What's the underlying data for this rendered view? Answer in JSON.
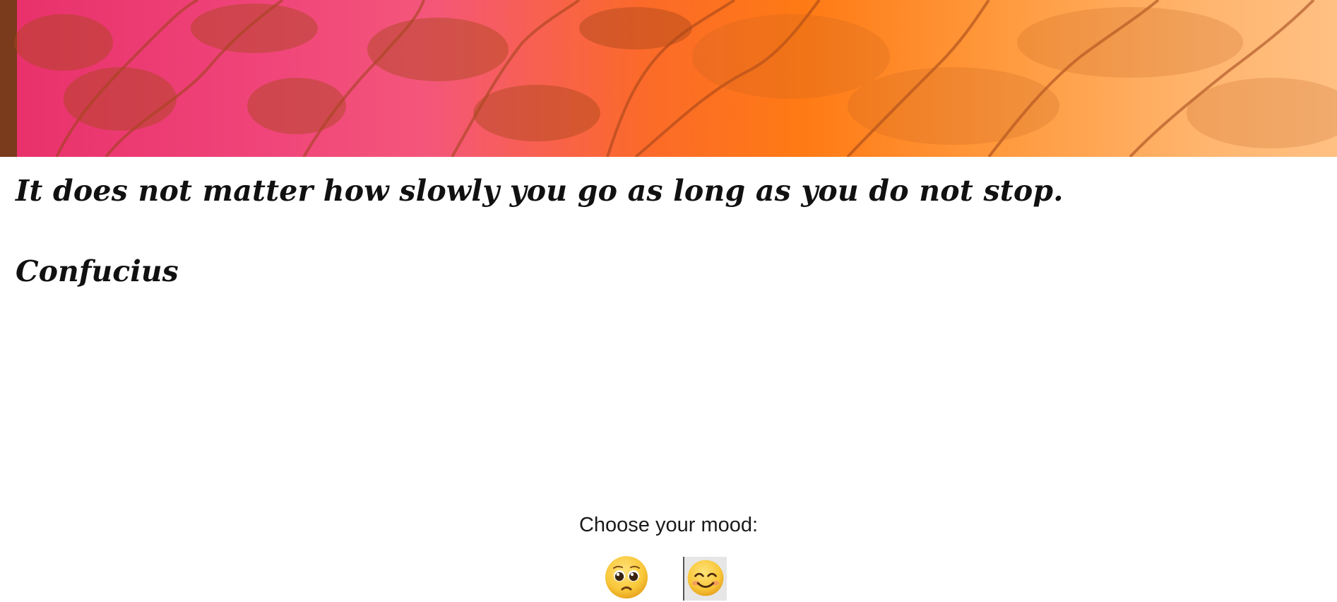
{
  "hero": {
    "image": "orange-pink-tree-silhouette-banner"
  },
  "quote": {
    "text": "It does not matter how slowly you go as long as you do not stop.",
    "author": "Confucius"
  },
  "mood": {
    "label": "Choose your mood:",
    "options": [
      {
        "name": "pleading-face-emoji",
        "aria": "sad"
      },
      {
        "name": "smiling-face-emoji",
        "aria": "happy"
      }
    ]
  }
}
